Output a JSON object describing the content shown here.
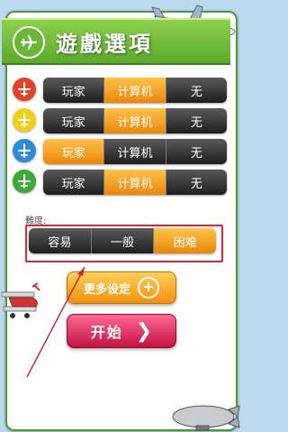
{
  "header": {
    "title": "遊戲選項"
  },
  "rows": [
    {
      "color": "#e0432c",
      "options": [
        "玩家",
        "计算机",
        "无"
      ],
      "selected": 1
    },
    {
      "color": "#f0d016",
      "options": [
        "玩家",
        "计算机",
        "无"
      ],
      "selected": 1
    },
    {
      "color": "#2d8ad8",
      "options": [
        "玩家",
        "计算机",
        "无"
      ],
      "selected": 0
    },
    {
      "color": "#3ea83a",
      "options": [
        "玩家",
        "计算机",
        "无"
      ],
      "selected": 1
    }
  ],
  "difficulty": {
    "label": "難度:",
    "options": [
      "容易",
      "一般",
      "困难"
    ],
    "selected": 2
  },
  "buttons": {
    "more_settings": "更多设定",
    "start": "开始"
  },
  "icons": {
    "header": "airplane-icon",
    "player": "airplane-icon",
    "more": "plus-circle-icon",
    "start": "chevron-right-icon"
  }
}
